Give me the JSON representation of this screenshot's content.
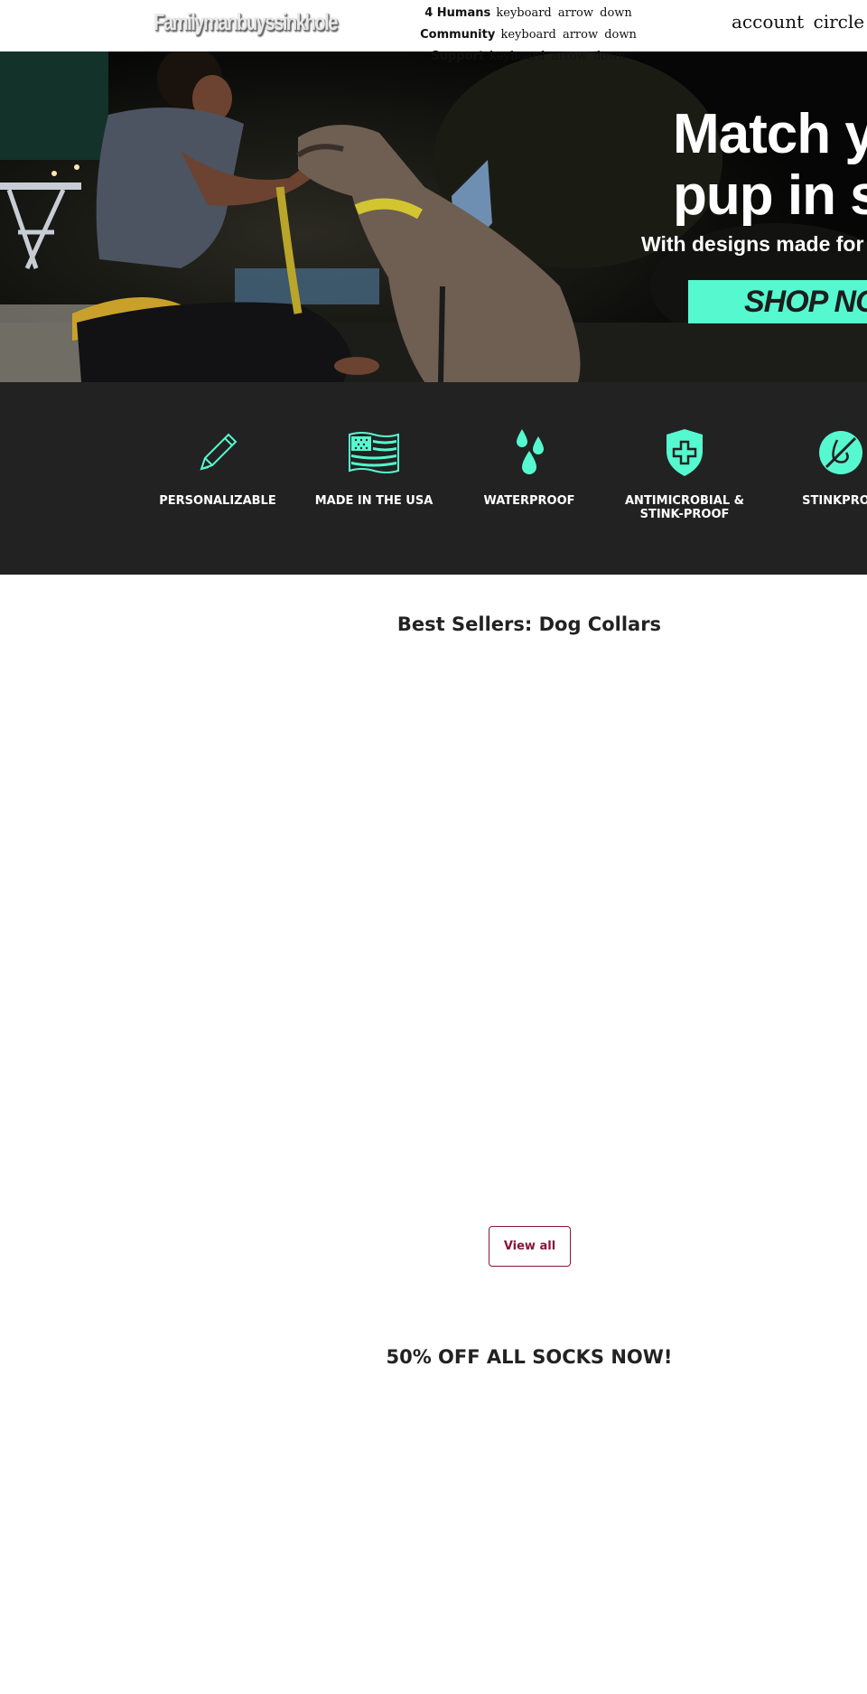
{
  "header": {
    "logo_text": "Familymanbuyssinkhole",
    "nav": [
      {
        "label": "4 Humans",
        "icon_text": "keyboard arrow down"
      },
      {
        "label": "Community",
        "icon_text": "keyboard arrow down"
      },
      {
        "label": "Support",
        "icon_text": "keyboard arrow down"
      }
    ],
    "icons_text": "account circle f"
  },
  "hero": {
    "headline_line1": "Match y",
    "headline_line2": "pup in st",
    "subheadline": "With designs made for s",
    "cta_label": "SHOP NO"
  },
  "features": {
    "items": [
      {
        "label": "PERSONALIZABLE",
        "icon": "pencil-icon"
      },
      {
        "label": "MADE IN THE USA",
        "icon": "us-flag-icon"
      },
      {
        "label": "WATERPROOF",
        "icon": "water-drops-icon"
      },
      {
        "label": "ANTIMICROBIAL & STINK-PROOF",
        "icon": "shield-cross-icon"
      },
      {
        "label": "STINKPROO",
        "icon": "no-smell-icon"
      }
    ],
    "accent_color": "#56f9cf"
  },
  "best_sellers": {
    "title": "Best Sellers: Dog Collars",
    "view_all_label": "View all"
  },
  "socks": {
    "title": "50% OFF ALL SOCKS NOW!"
  },
  "colors": {
    "band_background": "#222222",
    "button_border": "#8a1538",
    "accent": "#56f9cf"
  }
}
